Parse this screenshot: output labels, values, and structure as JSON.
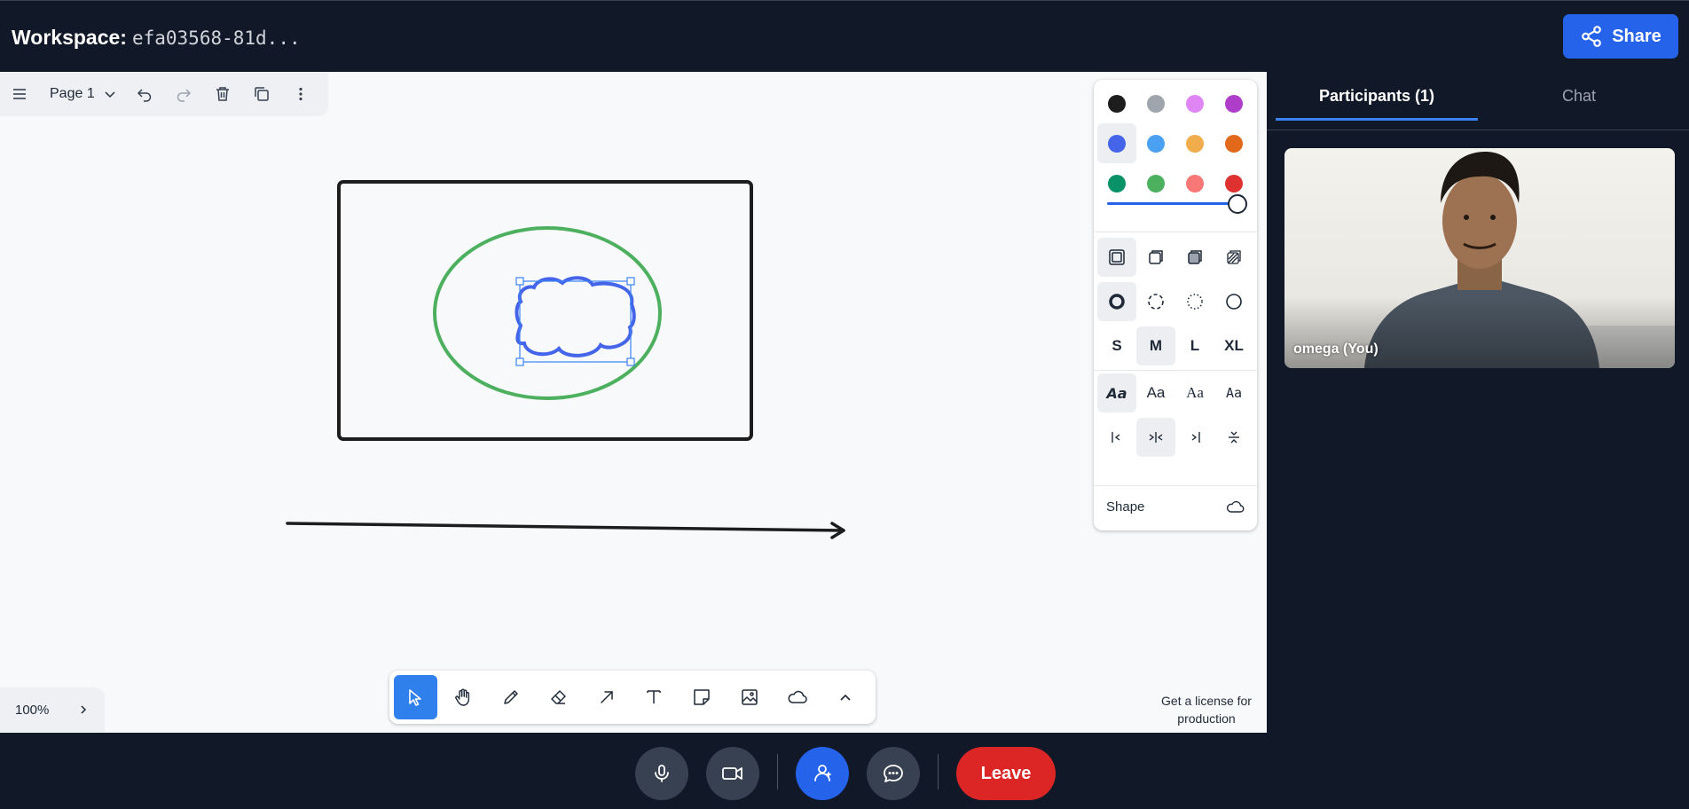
{
  "header": {
    "workspace_label": "Workspace:",
    "workspace_id": "efa03568-81d...",
    "share_label": "Share",
    "share_icon": "share-nodes-icon"
  },
  "page_toolbar": {
    "page_label": "Page 1",
    "icons": [
      "menu-icon",
      "chevron-down-icon",
      "undo-icon",
      "redo-icon",
      "trash-icon",
      "duplicate-icon",
      "more-vertical-icon"
    ]
  },
  "style_panel": {
    "colors": [
      {
        "name": "black",
        "hex": "#1d1d1d"
      },
      {
        "name": "grey",
        "hex": "#9ea5ad"
      },
      {
        "name": "light-violet",
        "hex": "#e085f4"
      },
      {
        "name": "violet",
        "hex": "#ae3ec9"
      },
      {
        "name": "blue",
        "hex": "#4465e9",
        "selected": true
      },
      {
        "name": "light-blue",
        "hex": "#4ba1f1"
      },
      {
        "name": "yellow",
        "hex": "#f1ac4b"
      },
      {
        "name": "orange",
        "hex": "#e16919"
      },
      {
        "name": "green",
        "hex": "#099268"
      },
      {
        "name": "light-green",
        "hex": "#4cb05e"
      },
      {
        "name": "light-red",
        "hex": "#f87777"
      },
      {
        "name": "red",
        "hex": "#e03131"
      }
    ],
    "opacity": 1.0,
    "fill_options": [
      "fill-none-icon",
      "fill-semi-icon",
      "fill-solid-icon",
      "fill-pattern-icon"
    ],
    "fill_selected": 0,
    "dash_options": [
      "dash-draw-icon",
      "dash-dashed-icon",
      "dash-dotted-icon",
      "dash-solid-icon"
    ],
    "dash_selected": 0,
    "sizes": [
      "S",
      "M",
      "L",
      "XL"
    ],
    "size_selected": 1,
    "font_label": "Aa",
    "font_selected": 0,
    "align_options": [
      "align-start-icon",
      "align-middle-icon",
      "align-end-icon",
      "align-stretch-icon"
    ],
    "align_selected": 1,
    "shape_label": "Shape",
    "shape_icon": "cloud-icon"
  },
  "tools": [
    "select-icon",
    "hand-icon",
    "pencil-icon",
    "eraser-icon",
    "arrow-icon",
    "text-icon",
    "sticky-note-icon",
    "image-icon",
    "cloud-icon",
    "chevron-up-icon"
  ],
  "zoom": {
    "label": "100%"
  },
  "license": {
    "text": "Get a license for production"
  },
  "sidebar": {
    "tabs": [
      {
        "label": "Participants (1)",
        "active": true
      },
      {
        "label": "Chat",
        "active": false
      }
    ],
    "participant_name": "omega (You)"
  },
  "callbar": {
    "buttons": [
      "microphone-icon",
      "camera-icon",
      "participants-icon",
      "chat-icon"
    ],
    "leave_label": "Leave"
  }
}
